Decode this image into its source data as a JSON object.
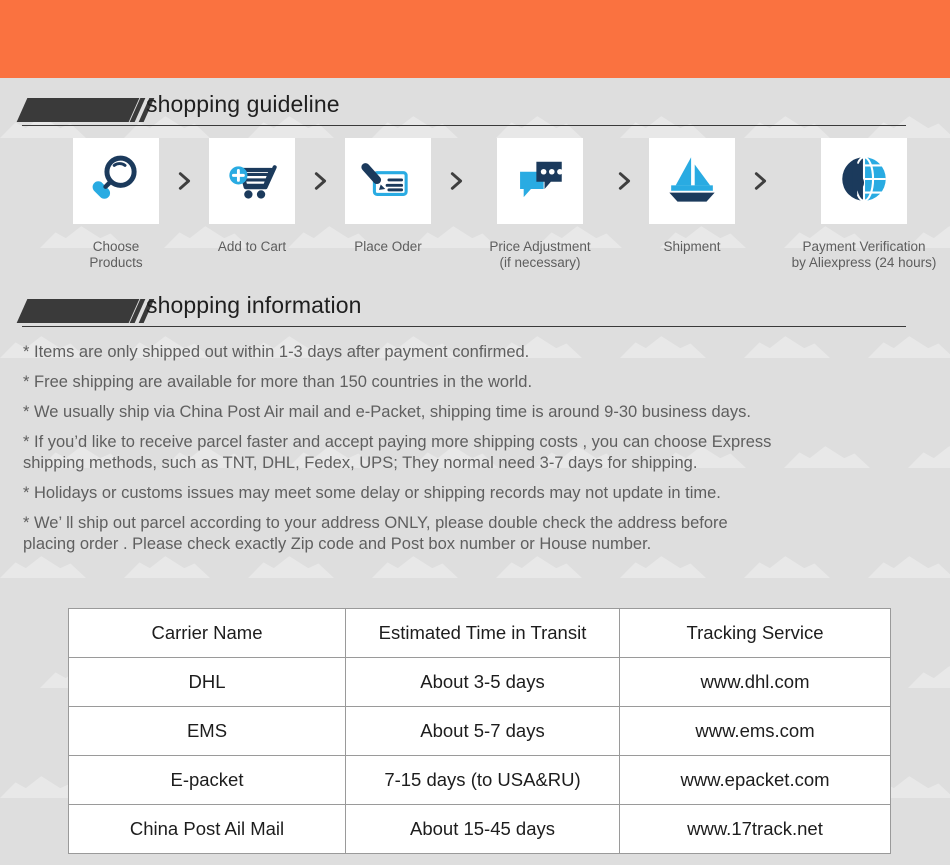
{
  "colors": {
    "banner": "#fa7240",
    "page_background": "#dedede",
    "heading_dark": "#3a3a3a",
    "icon_navy": "#1b3a5c",
    "icon_blue": "#29abe2",
    "tile_white": "#ffffff",
    "body_text": "#5f5f5f",
    "table_border": "#9a9a9a"
  },
  "sections": {
    "guideline": {
      "title": "shopping guideline"
    },
    "information": {
      "title": "shopping information"
    }
  },
  "steps": [
    {
      "icon": "magnifier-icon",
      "label": "Choose Products"
    },
    {
      "icon": "add-to-cart-icon",
      "label": "Add to Cart"
    },
    {
      "icon": "pen-check-icon",
      "label": "Place Oder"
    },
    {
      "icon": "chat-bubbles-icon",
      "label": "Price Adjustment\n(if necessary)"
    },
    {
      "icon": "sailboat-icon",
      "label": "Shipment"
    },
    {
      "icon": "dollar-globe-icon",
      "label": "Payment Verification\nby  Aliexpress (24 hours)"
    }
  ],
  "step_separator": "›",
  "info_lines": [
    "* Items are only shipped out within 1-3 days after payment confirmed.",
    "* Free shipping are available for more than 150 countries in the world.",
    "* We usually ship via China Post Air mail and e-Packet, shipping time is around 9-30 business days.",
    "* If you’d like to receive parcel faster and accept paying more shipping costs , you can choose Express\n   shipping methods, such as TNT, DHL, Fedex, UPS; They normal need 3-7 days for shipping.",
    "* Holidays or customs issues may meet some delay or shipping records may not update in time.",
    "* We’ ll ship out parcel according to your address ONLY, please double check the address before\n   placing order . Please check exactly Zip code and Post box number or House number."
  ],
  "carrier_table": {
    "headers": [
      "Carrier Name",
      "Estimated Time in Transit",
      "Tracking Service"
    ],
    "rows": [
      [
        "DHL",
        "About 3-5 days",
        "www.dhl.com"
      ],
      [
        "EMS",
        "About 5-7 days",
        "www.ems.com"
      ],
      [
        "E-packet",
        "7-15 days (to USA&RU)",
        "www.epacket.com"
      ],
      [
        "China Post Ail Mail",
        "About 15-45 days",
        "www.17track.net"
      ]
    ]
  }
}
